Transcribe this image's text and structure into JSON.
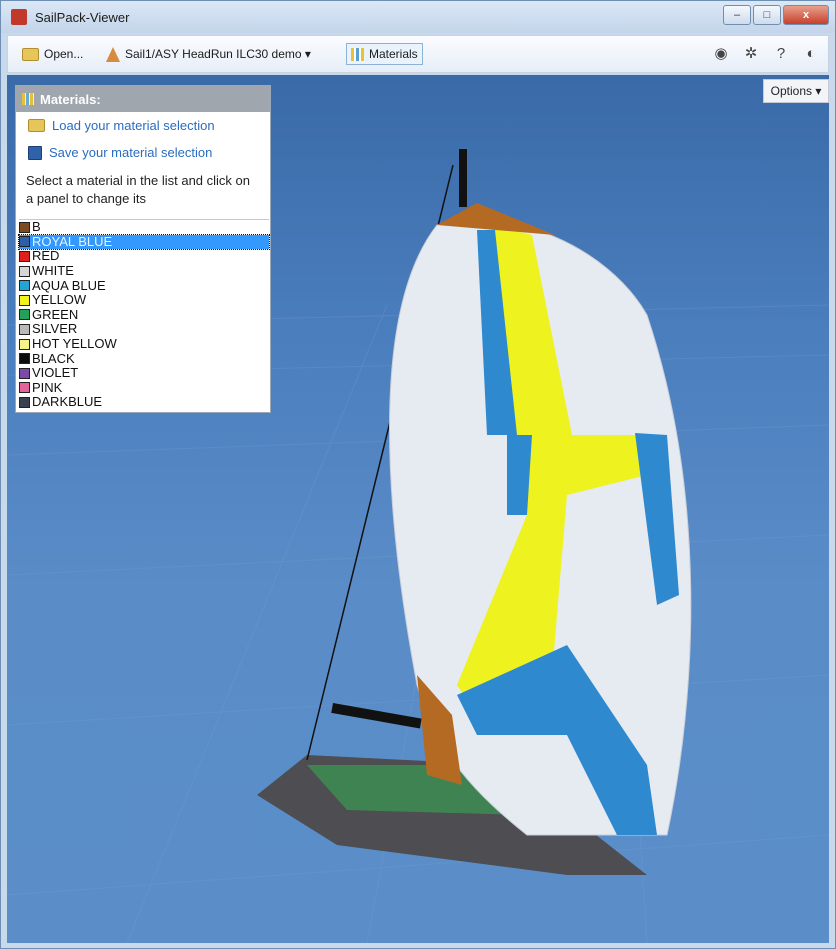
{
  "window": {
    "title": "SailPack-Viewer"
  },
  "toolbar": {
    "open_label": "Open...",
    "project_label": "Sail1/ASY HeadRun ILC30 demo ▾",
    "materials_label": "Materials",
    "icons": [
      "eye-icon",
      "gear-icon",
      "help-icon",
      "logo-icon"
    ]
  },
  "viewport": {
    "options_label": "Options ▾"
  },
  "materials_panel": {
    "title": "Materials:",
    "load_label": "Load your material selection",
    "save_label": "Save your material selection",
    "instruction": "Select a material in the list and click on a panel to change its",
    "selected": "ROYAL BLUE",
    "items": [
      {
        "name": "B",
        "color": "#7b4a1e"
      },
      {
        "name": "ROYAL BLUE",
        "color": "#2c5fa8"
      },
      {
        "name": "RED",
        "color": "#e0201c"
      },
      {
        "name": "WHITE",
        "color": "#d6d6d6"
      },
      {
        "name": "AQUA BLUE",
        "color": "#1fa5d8"
      },
      {
        "name": "YELLOW",
        "color": "#f2f21c"
      },
      {
        "name": "GREEN",
        "color": "#24a05a"
      },
      {
        "name": "SILVER",
        "color": "#b9b9b9"
      },
      {
        "name": "HOT YELLOW",
        "color": "#f6f38a"
      },
      {
        "name": "BLACK",
        "color": "#0c0c0c"
      },
      {
        "name": "VIOLET",
        "color": "#7c4aa6"
      },
      {
        "name": "PINK",
        "color": "#e4649a"
      },
      {
        "name": "DARKBLUE",
        "color": "#3b4050"
      }
    ]
  },
  "colors": {
    "sky": "#4b7ebd",
    "accent": "#3399ff"
  }
}
